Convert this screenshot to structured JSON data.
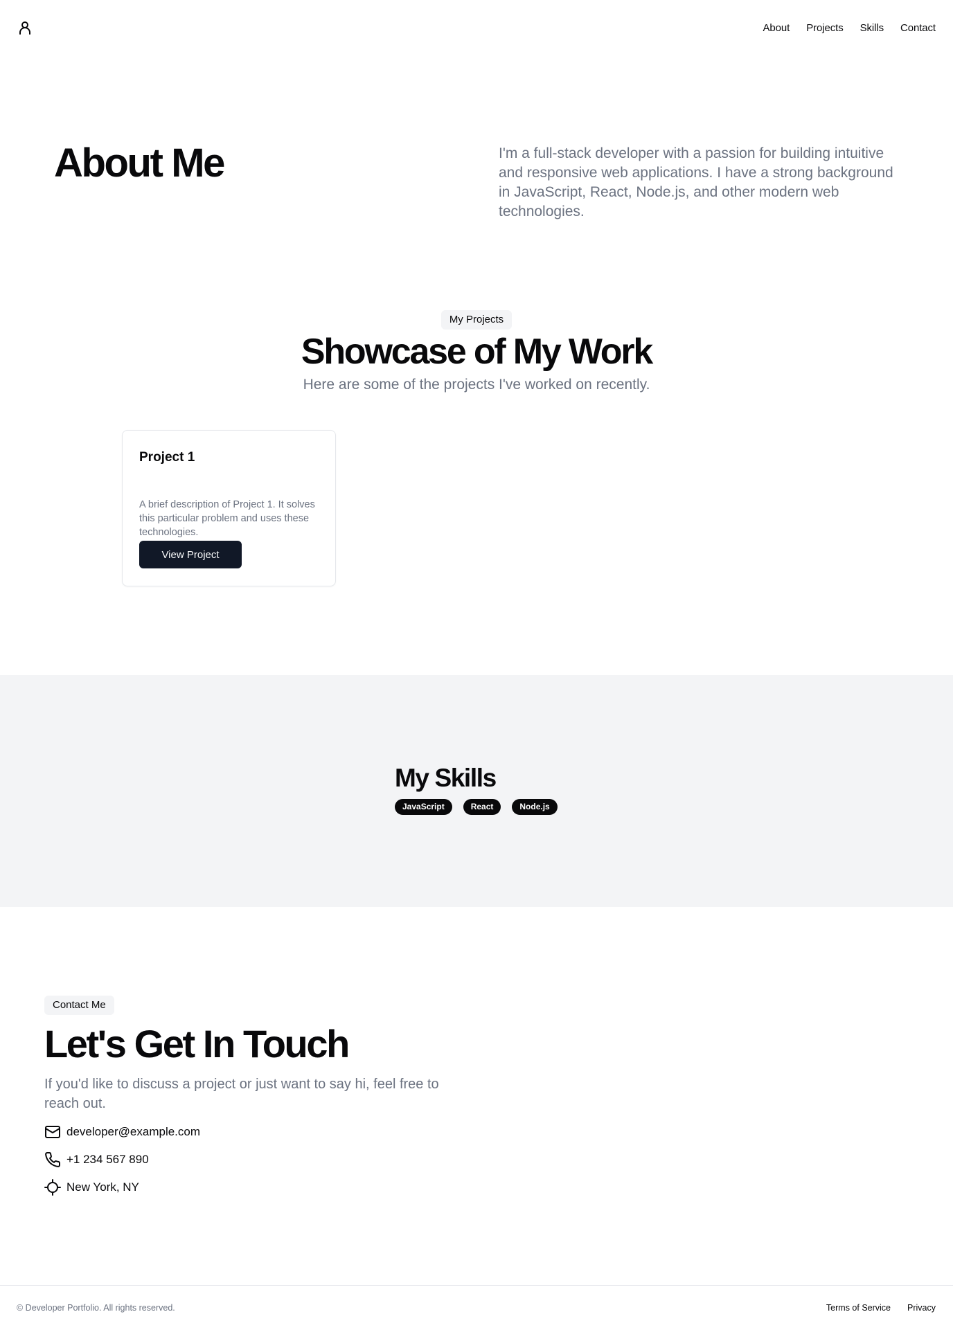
{
  "header": {
    "logo_icon": "user-icon",
    "nav": [
      "About",
      "Projects",
      "Skills",
      "Contact"
    ]
  },
  "about": {
    "title": "About Me",
    "text": "I'm a full-stack developer with a passion for building intuitive and responsive web applications. I have a strong background in JavaScript, React, Node.js, and other modern web technologies."
  },
  "projects": {
    "badge": "My Projects",
    "title": "Showcase of My Work",
    "subtitle": "Here are some of the projects I've worked on recently.",
    "items": [
      {
        "title": "Project 1",
        "description": "A brief description of Project 1. It solves this particular problem and uses these technologies.",
        "button": "View Project"
      }
    ]
  },
  "skills": {
    "title": "My Skills",
    "items": [
      "JavaScript",
      "React",
      "Node.js"
    ]
  },
  "contact": {
    "badge": "Contact Me",
    "title": "Let's Get In Touch",
    "subtitle": "If you'd like to discuss a project or just want to say hi, feel free to reach out.",
    "email": "developer@example.com",
    "phone": "+1 234 567 890",
    "location": "New York, NY",
    "icons": [
      "mail-icon",
      "phone-icon",
      "location-icon"
    ]
  },
  "footer": {
    "copyright": "© Developer Portfolio. All rights reserved.",
    "links": [
      "Terms of Service",
      "Privacy"
    ]
  },
  "colors": {
    "primary_dark": "#111827",
    "muted_text": "#6b7280",
    "muted_bg": "#f3f4f6",
    "border": "#e5e7eb"
  }
}
